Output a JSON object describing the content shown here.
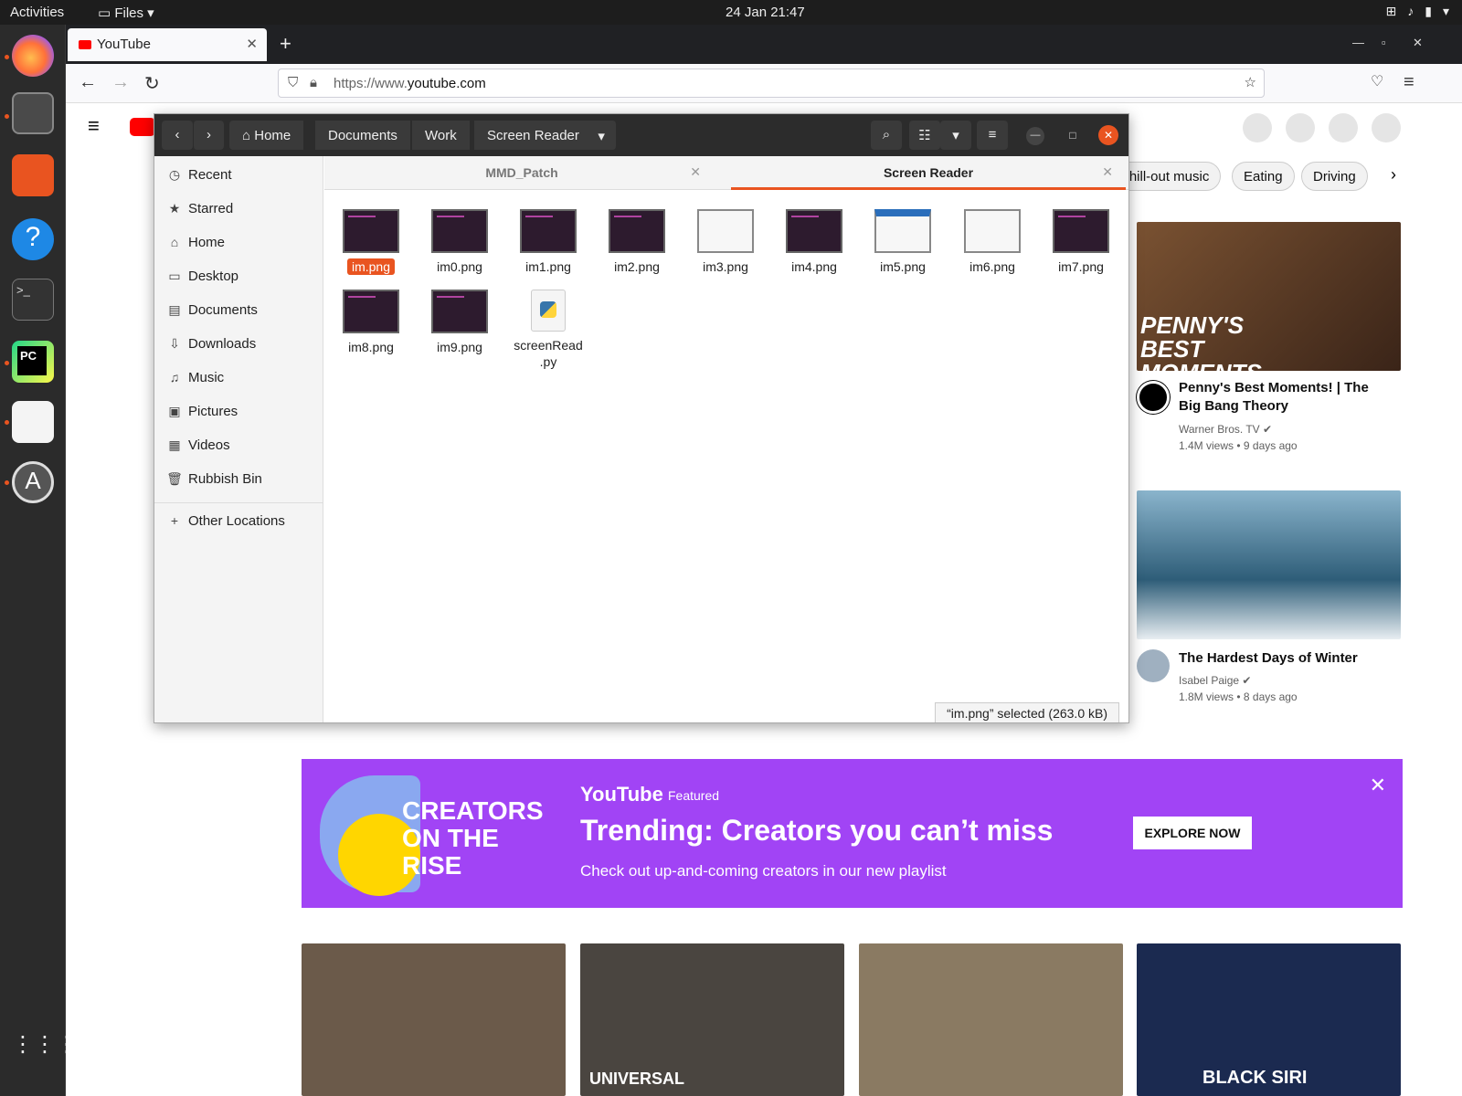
{
  "topbar": {
    "activities": "Activities",
    "files_menu": "Files",
    "clock": "24 Jan  21:47"
  },
  "dock": {
    "apps": [
      "firefox-icon",
      "files-icon",
      "software-icon",
      "help-icon",
      "terminal-icon",
      "pycharm-icon",
      "text-editor-icon",
      "updater-icon",
      "app-grid-icon"
    ]
  },
  "browser": {
    "tab_title": "YouTube",
    "url_prefix": "https://www.",
    "url_domain": "youtube.com"
  },
  "youtube": {
    "chips": [
      "Chill-out music",
      "Eating",
      "Driving"
    ],
    "videos_side": [
      {
        "thumb_text": "PENNY'S BEST MOMENTS",
        "title": "Penny's Best Moments! | The Big Bang Theory",
        "channel": "Warner Bros. TV",
        "views": "1.4M views • 9 days ago",
        "thumb_color": "#5a3a20"
      },
      {
        "title": "The Hardest Days of Winter",
        "channel": "Isabel Paige",
        "views": "1.8M views • 8 days ago",
        "thumb_color": "#3e6e8a"
      }
    ],
    "banner": {
      "brand": "YouTube",
      "featured": "Featured",
      "headline": "Trending: Creators you can’t miss",
      "subtext": "Check out up-and-coming creators in our new playlist",
      "button": "EXPLORE NOW",
      "logo_line1": "CREATORS",
      "logo_line2": "ON THE",
      "logo_line3": "RISE",
      "color": "#a144f5"
    },
    "bottom_thumbs": [
      {
        "color": "#6b5a4a",
        "text": ""
      },
      {
        "color": "#4a4540",
        "text": "UNIVERSAL"
      },
      {
        "color": "#8a7a62",
        "text": ""
      },
      {
        "color": "#1b2a50",
        "text": "BLACK SIRI"
      }
    ]
  },
  "files": {
    "breadcrumbs": [
      "Home",
      "Documents",
      "Work",
      "Screen Reader"
    ],
    "sidebar": [
      "Recent",
      "Starred",
      "Home",
      "Desktop",
      "Documents",
      "Downloads",
      "Music",
      "Pictures",
      "Videos",
      "Rubbish Bin"
    ],
    "other_locations": "Other Locations",
    "tabs": [
      "MMD_Patch",
      "Screen Reader"
    ],
    "items": [
      "im.png",
      "im0.png",
      "im1.png",
      "im2.png",
      "im3.png",
      "im4.png",
      "im5.png",
      "im6.png",
      "im7.png",
      "im8.png",
      "im9.png",
      "screenRead\n.py"
    ],
    "status": "“im.png” selected  (263.0 kB)"
  }
}
